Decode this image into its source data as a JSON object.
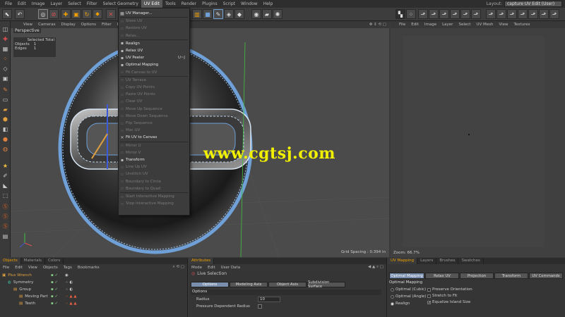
{
  "menubar": {
    "items": [
      "File",
      "Edit",
      "Image",
      "Layer",
      "Select",
      "Filter",
      "Select Geometry",
      "UV Edit",
      "Tools",
      "Render",
      "Plugins",
      "Script",
      "Window",
      "Help"
    ],
    "active_index": 7,
    "layout_label": "Layout:",
    "layout_value": "capture UV Edit (User)"
  },
  "viewport": {
    "menu": [
      "View",
      "Cameras",
      "Display",
      "Options",
      "Filter",
      "Panel"
    ],
    "title": "Perspective",
    "selected_header": "Selected Total",
    "objects_label": "Objects",
    "objects_value": "1",
    "edges_label": "Edges",
    "edges_value": "1",
    "grid_spacing": "Grid Spacing : 0.394 in"
  },
  "watermark": "www.cgtsj.com",
  "uv_menu": {
    "items": [
      {
        "label": "UV Manager...",
        "enabled": true,
        "icon": "▦"
      },
      {
        "label": "Store UV",
        "enabled": false,
        "icon": "▫"
      },
      {
        "label": "Restore UV",
        "enabled": false,
        "icon": "▫"
      },
      {
        "label": "Relax...",
        "enabled": false,
        "icon": "▫"
      },
      {
        "label": "Realign",
        "enabled": true,
        "icon": "▪"
      },
      {
        "label": "Relax UV",
        "enabled": true,
        "icon": "▪"
      },
      {
        "label": "UV Peeler",
        "enabled": true,
        "icon": "▪",
        "shortcut": "U~J"
      },
      {
        "label": "Optimal Mapping",
        "enabled": true,
        "icon": "▪"
      },
      {
        "label": "Fit Canvas to UV",
        "enabled": false,
        "icon": "▫"
      },
      {
        "label": "UV Terrace",
        "enabled": false,
        "icon": "▫"
      },
      {
        "label": "Copy UV Points",
        "enabled": false,
        "icon": "▫"
      },
      {
        "label": "Paste UV Points",
        "enabled": false,
        "icon": "▫"
      },
      {
        "label": "Clear UV",
        "enabled": false,
        "icon": "▫"
      },
      {
        "label": "Move Up Sequence",
        "enabled": false,
        "icon": "▫"
      },
      {
        "label": "Move Down Sequence",
        "enabled": false,
        "icon": "▫"
      },
      {
        "label": "Flip Sequence",
        "enabled": false,
        "icon": "▫"
      },
      {
        "label": "Mac UV",
        "enabled": false,
        "icon": "▫"
      },
      {
        "label": "Fit UV to Canvas",
        "enabled": true,
        "icon": "✕"
      },
      {
        "label": "Mirror U",
        "enabled": false,
        "icon": "▫"
      },
      {
        "label": "Mirror V",
        "enabled": false,
        "icon": "▫"
      },
      {
        "label": "Transform",
        "enabled": true,
        "icon": "▪"
      },
      {
        "label": "Line Up UV",
        "enabled": false,
        "icon": "▫"
      },
      {
        "label": "Unstitch UV",
        "enabled": false,
        "icon": "▫"
      },
      {
        "label": "Boundary to Circle",
        "enabled": false,
        "icon": "▫"
      },
      {
        "label": "Boundary to Quad",
        "enabled": false,
        "icon": "▫"
      },
      {
        "label": "Start Interactive Mapping",
        "enabled": false,
        "icon": "▫"
      },
      {
        "label": "Stop Interactive Mapping",
        "enabled": false,
        "icon": "▫"
      }
    ]
  },
  "uv_panel": {
    "menu": [
      "File",
      "Edit",
      "Image",
      "Layer",
      "Select",
      "UV Mesh",
      "View",
      "Textures"
    ],
    "zoom": "Zoom: 66.7%"
  },
  "objects_panel": {
    "tabs": [
      "Objects",
      "Materials",
      "Colors"
    ],
    "menu": [
      "File",
      "Edit",
      "View",
      "Objects",
      "Tags",
      "Bookmarks"
    ],
    "rows": [
      {
        "name": "Plus Wrench",
        "indent": 0,
        "color": "#e0a040"
      },
      {
        "name": "Symmetry",
        "indent": 1,
        "color": "#cccccc"
      },
      {
        "name": "Group",
        "indent": 2,
        "color": "#cccccc"
      },
      {
        "name": "Moving Part",
        "indent": 3,
        "color": "#cccccc"
      },
      {
        "name": "Teeth",
        "indent": 3,
        "color": "#cccccc"
      }
    ]
  },
  "attributes": {
    "tab": "Attributes",
    "menu": [
      "Mode",
      "Edit",
      "User Data"
    ],
    "title": "Live Selection",
    "tabs": [
      "Options",
      "Modeling Axis",
      "Object Axis",
      "Subdivision Surface"
    ],
    "section": "Options",
    "radius_label": "Radius",
    "radius_value": "10",
    "pressure_label": "Pressure Dependent Radius"
  },
  "uv_mapping": {
    "tabs": [
      "UV Mapping",
      "Layers",
      "Brushes",
      "Swatches"
    ],
    "subtabs": [
      "Optimal Mapping",
      "Relax UV",
      "Projection",
      "Transform",
      "UV Commands"
    ],
    "section": "Optimal Mapping",
    "radios": [
      "Optimal (Cubic)",
      "Optimal (Angle)",
      "Realign"
    ],
    "checks": [
      {
        "label": "Preserve Orientation",
        "checked": false
      },
      {
        "label": "Stretch to Fit",
        "checked": false
      },
      {
        "label": "Equalize Island Size",
        "checked": true
      }
    ]
  },
  "colors": {
    "accent": "#f0a000",
    "selected_tab": "#7a8fae",
    "wire": "#6fa0d8",
    "watermark": "#f0f000"
  }
}
